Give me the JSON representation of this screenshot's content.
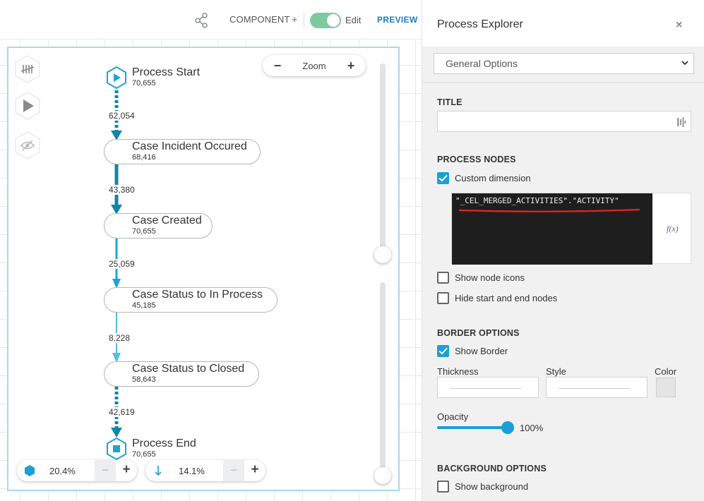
{
  "toolbar": {
    "share_icon": "share-nodes-icon",
    "component_label": "COMPONENT",
    "component_plus": "+",
    "edit_toggle_on": true,
    "edit_label": "Edit",
    "preview_label": "PREVIEW"
  },
  "canvas": {
    "side_tools": [
      {
        "icon": "tally-marks-icon",
        "label": "counts"
      },
      {
        "icon": "play-icon",
        "label": "play"
      },
      {
        "icon": "eye-slash-icon",
        "label": "hide"
      }
    ],
    "zoom": {
      "minus": "−",
      "label": "Zoom",
      "plus": "+"
    },
    "activity_slider_value": "20.4%",
    "connection_slider_value": "14.1%",
    "bottom_minus": "−",
    "bottom_plus": "+"
  },
  "process": {
    "nodes": [
      {
        "name": "Process Start",
        "count": "70,655",
        "kind": "start"
      },
      {
        "name": "Case Incident Occured",
        "count": "68,416",
        "kind": "activity"
      },
      {
        "name": "Case Created",
        "count": "70,655",
        "kind": "activity"
      },
      {
        "name": "Case Status to In Process",
        "count": "45,185",
        "kind": "activity"
      },
      {
        "name": "Case Status to Closed",
        "count": "58,643",
        "kind": "activity"
      },
      {
        "name": "Process End",
        "count": "70,655",
        "kind": "end"
      }
    ],
    "edges": [
      {
        "label": "62,054",
        "style": "dashed"
      },
      {
        "label": "43,380",
        "style": "solid"
      },
      {
        "label": "25,059",
        "style": "solid"
      },
      {
        "label": "8,228",
        "style": "solid"
      },
      {
        "label": "42,619",
        "style": "dashed"
      }
    ],
    "colors": {
      "dark": "#0f86a8",
      "light": "#1ba5d4",
      "lighter": "#4cc0e6"
    }
  },
  "panel": {
    "title": "Process Explorer",
    "close": "×",
    "options_select": "General Options",
    "title_section": "TITLE",
    "title_value": "",
    "process_nodes_section": "PROCESS NODES",
    "custom_dimension_label": "Custom dimension",
    "custom_dimension_checked": true,
    "code": "\"_CEL_MERGED_ACTIVITIES\".\"ACTIVITY\"",
    "fx_label": "f(x)",
    "show_node_icons_label": "Show node icons",
    "show_node_icons_checked": false,
    "hide_start_end_label": "Hide start and end nodes",
    "hide_start_end_checked": false,
    "border_section": "BORDER OPTIONS",
    "show_border_label": "Show Border",
    "show_border_checked": true,
    "thickness_label": "Thickness",
    "style_label": "Style",
    "color_label": "Color",
    "color_value": "#e4e4e4",
    "opacity_label": "Opacity",
    "opacity_value": "100%",
    "opacity_fraction": 1.0,
    "background_section": "BACKGROUND OPTIONS",
    "show_background_label": "Show background",
    "show_background_checked": false,
    "accent": "#1a9fd6"
  }
}
